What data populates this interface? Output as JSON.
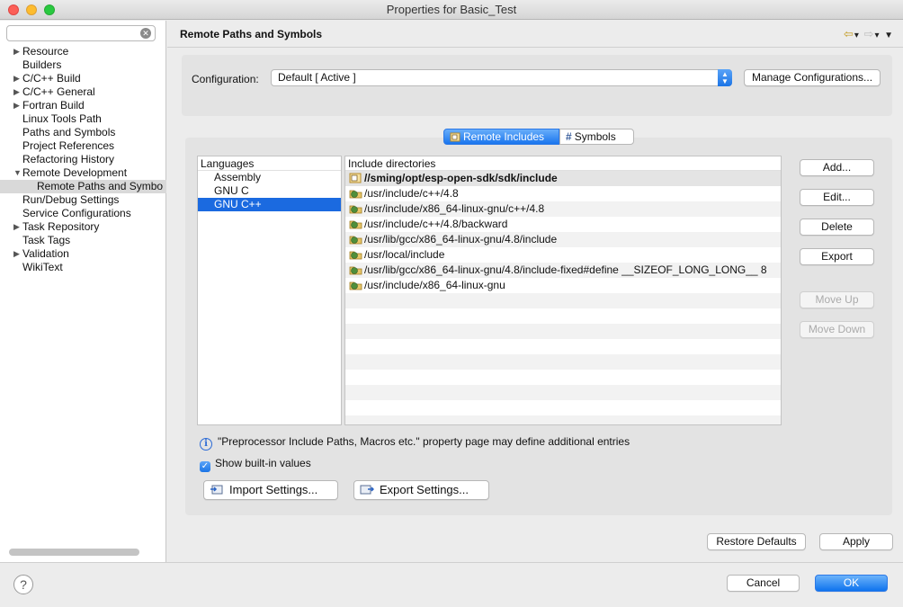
{
  "window": {
    "title": "Properties for Basic_Test"
  },
  "sidebar": {
    "search_value": "",
    "items": [
      {
        "label": "Resource",
        "expandable": true
      },
      {
        "label": "Builders",
        "expandable": false
      },
      {
        "label": "C/C++ Build",
        "expandable": true
      },
      {
        "label": "C/C++ General",
        "expandable": true
      },
      {
        "label": "Fortran Build",
        "expandable": true
      },
      {
        "label": "Linux Tools Path",
        "expandable": false
      },
      {
        "label": "Paths and Symbols",
        "expandable": false
      },
      {
        "label": "Project References",
        "expandable": false
      },
      {
        "label": "Refactoring History",
        "expandable": false
      },
      {
        "label": "Remote Development",
        "expandable": true,
        "expanded": true
      },
      {
        "label": "Remote Paths and Symbo",
        "child": true,
        "selected": true
      },
      {
        "label": "Run/Debug Settings",
        "expandable": false
      },
      {
        "label": "Service Configurations",
        "expandable": false
      },
      {
        "label": "Task Repository",
        "expandable": true
      },
      {
        "label": "Task Tags",
        "expandable": false
      },
      {
        "label": "Validation",
        "expandable": true
      },
      {
        "label": "WikiText",
        "expandable": false
      }
    ]
  },
  "header": {
    "title": "Remote Paths and Symbols"
  },
  "configuration": {
    "label": "Configuration:",
    "value": "Default  [ Active ]",
    "manage_label": "Manage Configurations..."
  },
  "tabs": [
    {
      "label": "Remote Includes",
      "active": true
    },
    {
      "label": "Symbols",
      "active": false
    }
  ],
  "languages": {
    "header": "Languages",
    "items": [
      "Assembly",
      "GNU C",
      "GNU C++"
    ],
    "selected": "GNU C++"
  },
  "includes": {
    "header": "Include directories",
    "items": [
      "//sming/opt/esp-open-sdk/sdk/include",
      "/usr/include/c++/4.8",
      "/usr/include/x86_64-linux-gnu/c++/4.8",
      "/usr/include/c++/4.8/backward",
      "/usr/lib/gcc/x86_64-linux-gnu/4.8/include",
      "/usr/local/include",
      "/usr/lib/gcc/x86_64-linux-gnu/4.8/include-fixed#define __SIZEOF_LONG_LONG__ 8",
      "/usr/include/x86_64-linux-gnu"
    ]
  },
  "side_buttons": {
    "add": "Add...",
    "edit": "Edit...",
    "delete": "Delete",
    "export": "Export",
    "move_up": "Move Up",
    "move_down": "Move Down"
  },
  "info_text": "\"Preprocessor Include Paths, Macros etc.\" property page may define additional entries",
  "show_builtin": {
    "label": "Show built-in values",
    "checked": true
  },
  "import_settings": "Import Settings...",
  "export_settings": "Export Settings...",
  "restore_defaults": "Restore Defaults",
  "apply": "Apply",
  "cancel": "Cancel",
  "ok": "OK"
}
